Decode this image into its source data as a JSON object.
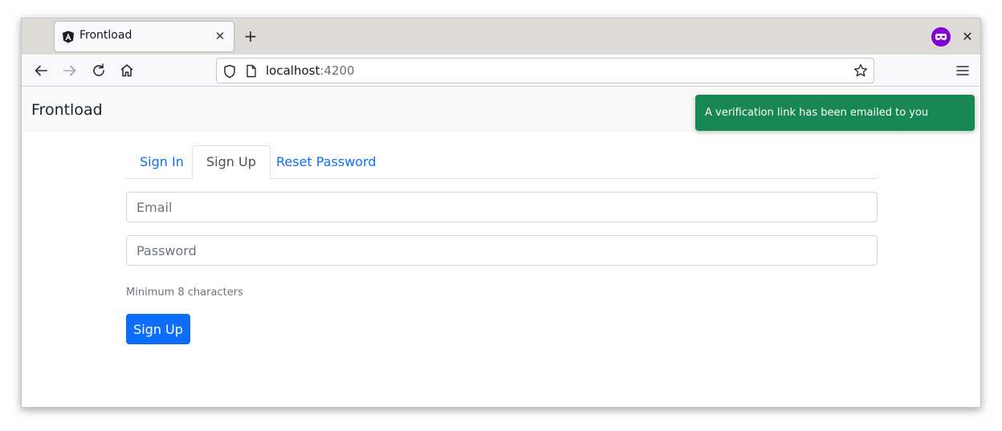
{
  "browser": {
    "tab_title": "Frontload",
    "tab_close": "✕",
    "new_tab": "+",
    "window_close": "✕",
    "url_host": "localhost",
    "url_port": ":4200"
  },
  "app": {
    "brand": "Frontload"
  },
  "toast": {
    "message": "A verification link has been emailed to you",
    "color": "#198754"
  },
  "tabs": [
    {
      "label": "Sign In",
      "active": false
    },
    {
      "label": "Sign Up",
      "active": true
    },
    {
      "label": "Reset Password",
      "active": false
    }
  ],
  "form": {
    "email_placeholder": "Email",
    "email_value": "",
    "password_placeholder": "Password",
    "password_value": "",
    "password_help": "Minimum 8 characters",
    "submit_label": "Sign Up"
  },
  "colors": {
    "accent": "#0d6efd",
    "success": "#198754"
  },
  "icons": [
    "angular-favicon-icon",
    "close-icon",
    "plus-icon",
    "private-browsing-icon",
    "back-arrow-icon",
    "forward-arrow-icon",
    "reload-icon",
    "home-icon",
    "shield-icon",
    "page-icon",
    "star-icon",
    "hamburger-menu-icon"
  ]
}
